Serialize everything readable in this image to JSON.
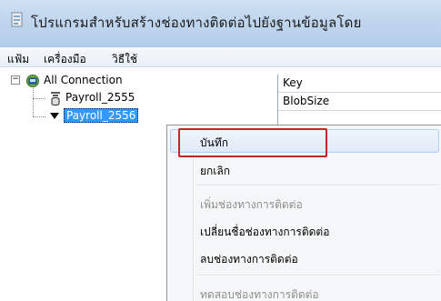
{
  "window": {
    "title": "โปรแกรมสำหรับสร้างช่องทางติดต่อไปยังฐานข้อมูลโดย"
  },
  "menubar": {
    "items": [
      {
        "label": "แฟ้ม"
      },
      {
        "label": "เครื่องมือ"
      },
      {
        "label": "วิธีใช้"
      }
    ]
  },
  "tree": {
    "root": {
      "label": "All Connection",
      "expander": "−",
      "icon": "connection-group-icon"
    },
    "children": [
      {
        "label": "Payroll_2555",
        "icon": "database-icon",
        "selected": false
      },
      {
        "label": "Payroll_2556",
        "icon": "dropdown-arrow-icon",
        "selected": true
      }
    ]
  },
  "grid": {
    "header": "Key",
    "rows": [
      {
        "label": "BlobSize"
      },
      {
        "label": ""
      }
    ]
  },
  "context_menu": {
    "items": [
      {
        "label": "บันทึก",
        "enabled": true,
        "hovered": true
      },
      {
        "label": "ยกเลิก",
        "enabled": true
      },
      {
        "label": "เพิ่มช่องทางการติดต่อ",
        "enabled": false
      },
      {
        "label": "เปลี่ยนชื่อช่องทางการติดต่อ",
        "enabled": true
      },
      {
        "label": "ลบช่องทางการติดต่อ",
        "enabled": true
      },
      {
        "label": "ทดสอบช่องทางการติดต่อ",
        "enabled": false
      }
    ]
  },
  "colors": {
    "highlight_border": "#c8232c",
    "selection": "#3399ff",
    "titlebar": "#c0d6ee"
  }
}
